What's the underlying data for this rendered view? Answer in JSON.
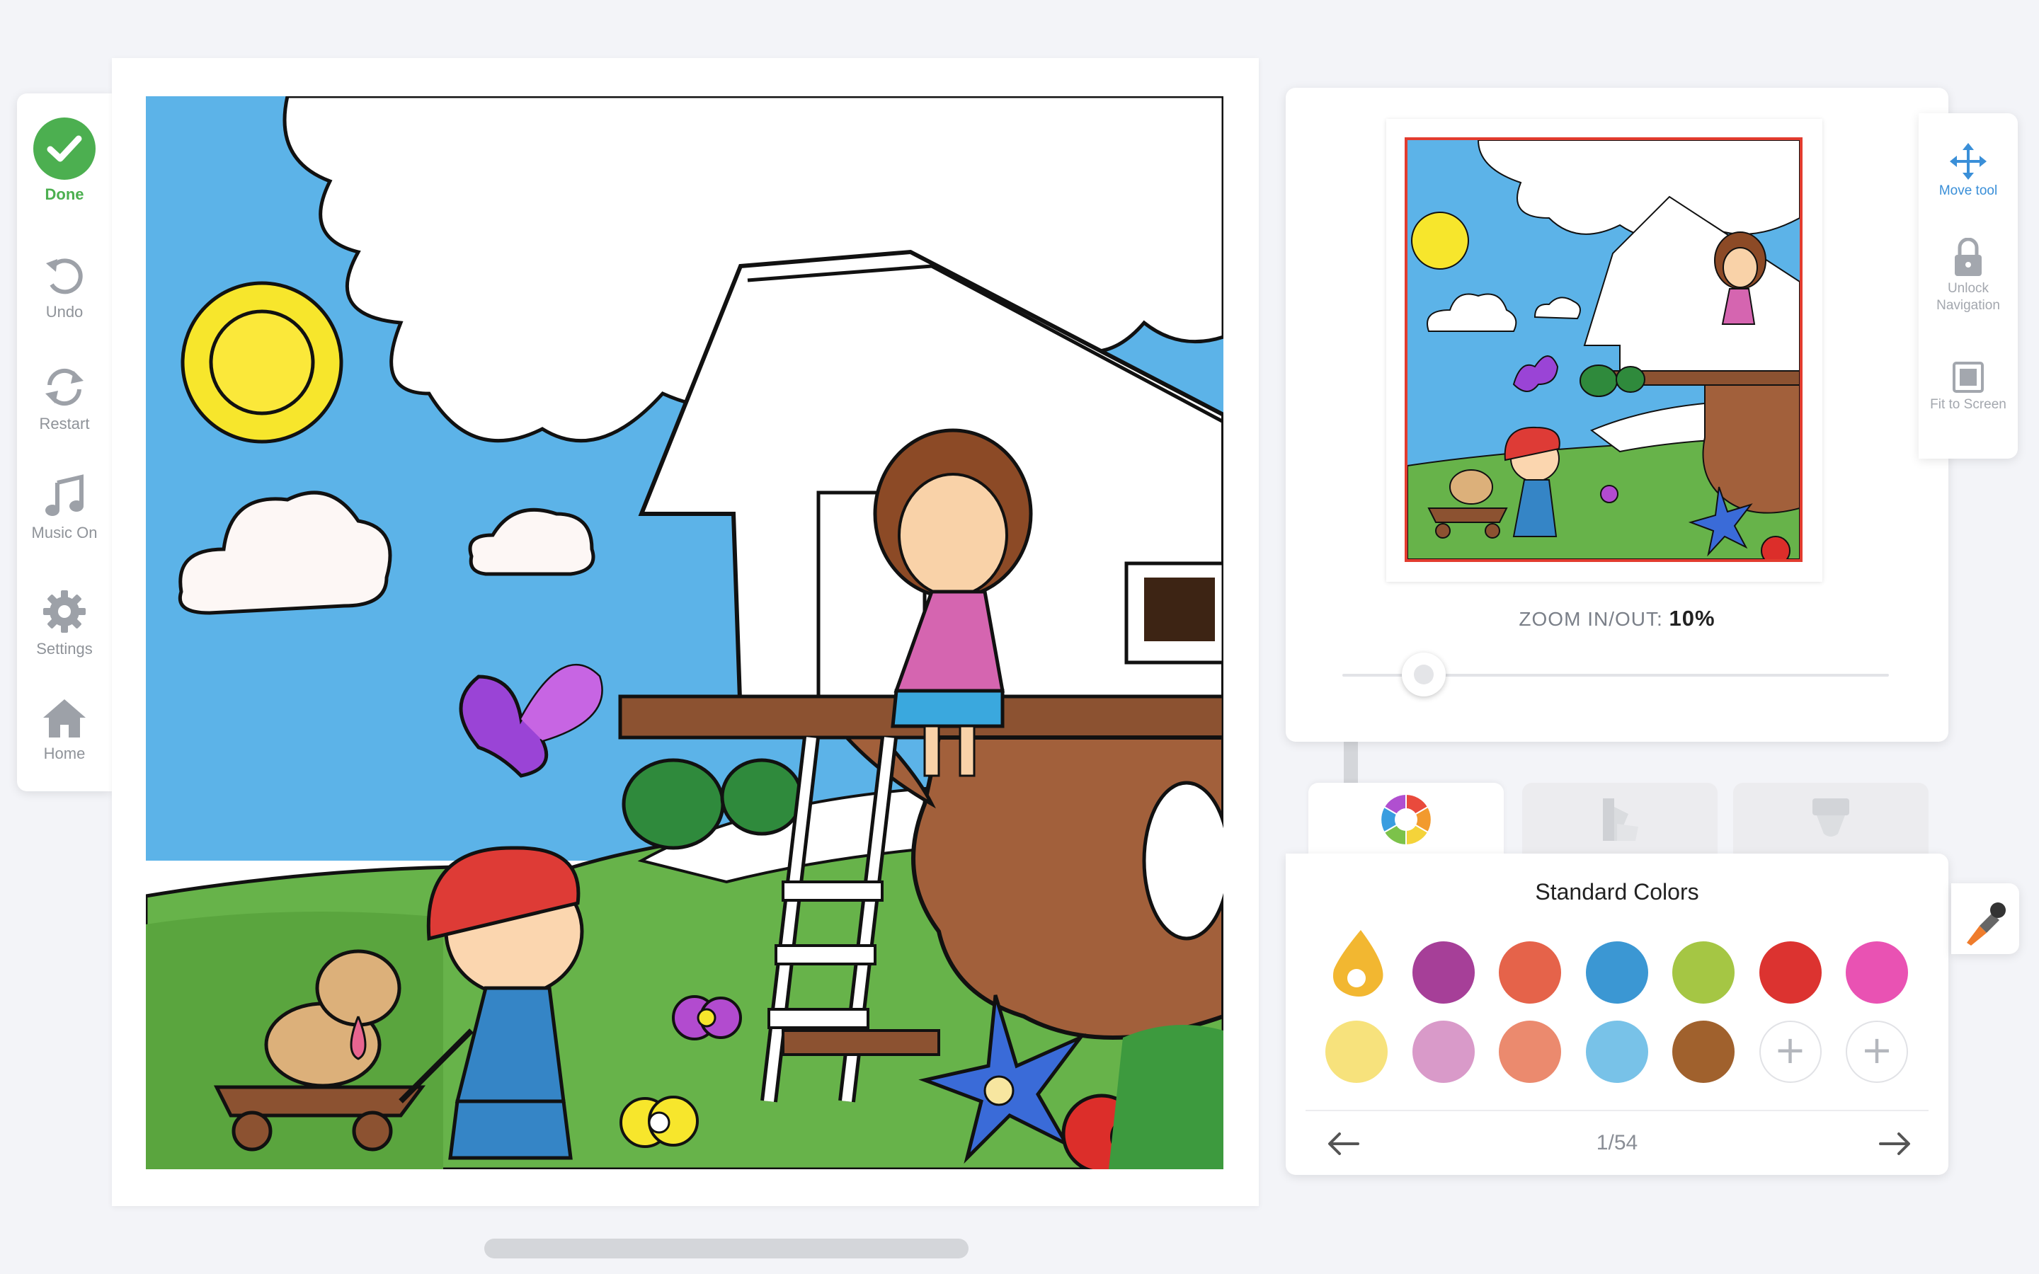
{
  "toolbar": {
    "done_label": "Done",
    "undo_label": "Undo",
    "restart_label": "Restart",
    "music_label": "Music On",
    "settings_label": "Settings",
    "home_label": "Home"
  },
  "navigator": {
    "zoom_label": "ZOOM IN/OUT:",
    "zoom_value": "10%",
    "zoom_fraction": 0.1
  },
  "nav_tools": {
    "move_label": "Move tool",
    "unlock_label": "Unlock Navigation",
    "fit_label": "Fit to Screen"
  },
  "palette": {
    "title": "Standard Colors",
    "page_indicator": "1/54",
    "swatches_row1": [
      "#f2b731",
      "#a63f98",
      "#e5634a",
      "#3b97d3",
      "#a5c644",
      "#dc3330",
      "#e952b3"
    ],
    "swatches_row2": [
      "#f7e27c",
      "#d99ac9",
      "#eb8a6e",
      "#78c2e8",
      "#a0612d",
      "add",
      "add"
    ]
  },
  "colors": {
    "accent": "#3a8fd8",
    "done": "#4caf50",
    "selection_frame": "#e23c2f"
  }
}
